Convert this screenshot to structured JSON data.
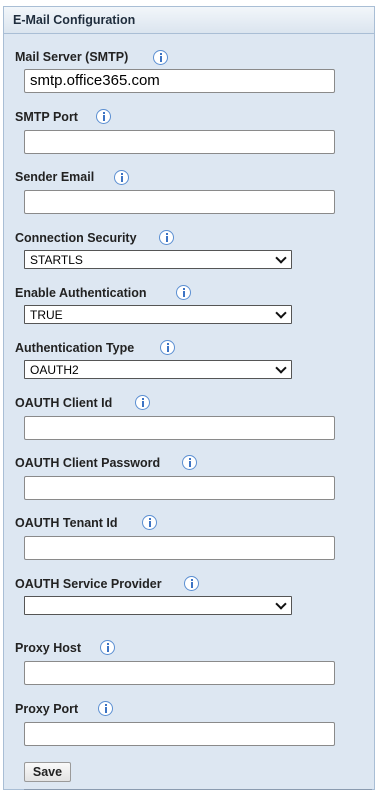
{
  "panel": {
    "title": "E-Mail Configuration"
  },
  "fields": {
    "mail_server": {
      "label": "Mail Server (SMTP)",
      "value": "smtp.office365.com"
    },
    "smtp_port": {
      "label": "SMTP Port",
      "value": ""
    },
    "sender_email": {
      "label": "Sender Email",
      "value": ""
    },
    "connection_security": {
      "label": "Connection Security",
      "value": "STARTLS"
    },
    "enable_authentication": {
      "label": "Enable Authentication",
      "value": "TRUE"
    },
    "authentication_type": {
      "label": "Authentication Type",
      "value": "OAUTH2"
    },
    "oauth_client_id": {
      "label": "OAUTH Client Id",
      "value": ""
    },
    "oauth_client_password": {
      "label": "OAUTH Client Password",
      "value": ""
    },
    "oauth_tenant_id": {
      "label": "OAUTH Tenant Id",
      "value": ""
    },
    "oauth_service_provider": {
      "label": "OAUTH Service Provider",
      "value": ""
    },
    "proxy_host": {
      "label": "Proxy Host",
      "value": ""
    },
    "proxy_port": {
      "label": "Proxy Port",
      "value": ""
    }
  },
  "actions": {
    "save_label": "Save"
  },
  "icons": {
    "info": "info-icon",
    "dropdown": "chevron-down-icon"
  },
  "colors": {
    "panel_bg": "#dde7f2",
    "panel_border": "#a9bed5",
    "info_icon": "#3d74c4"
  }
}
